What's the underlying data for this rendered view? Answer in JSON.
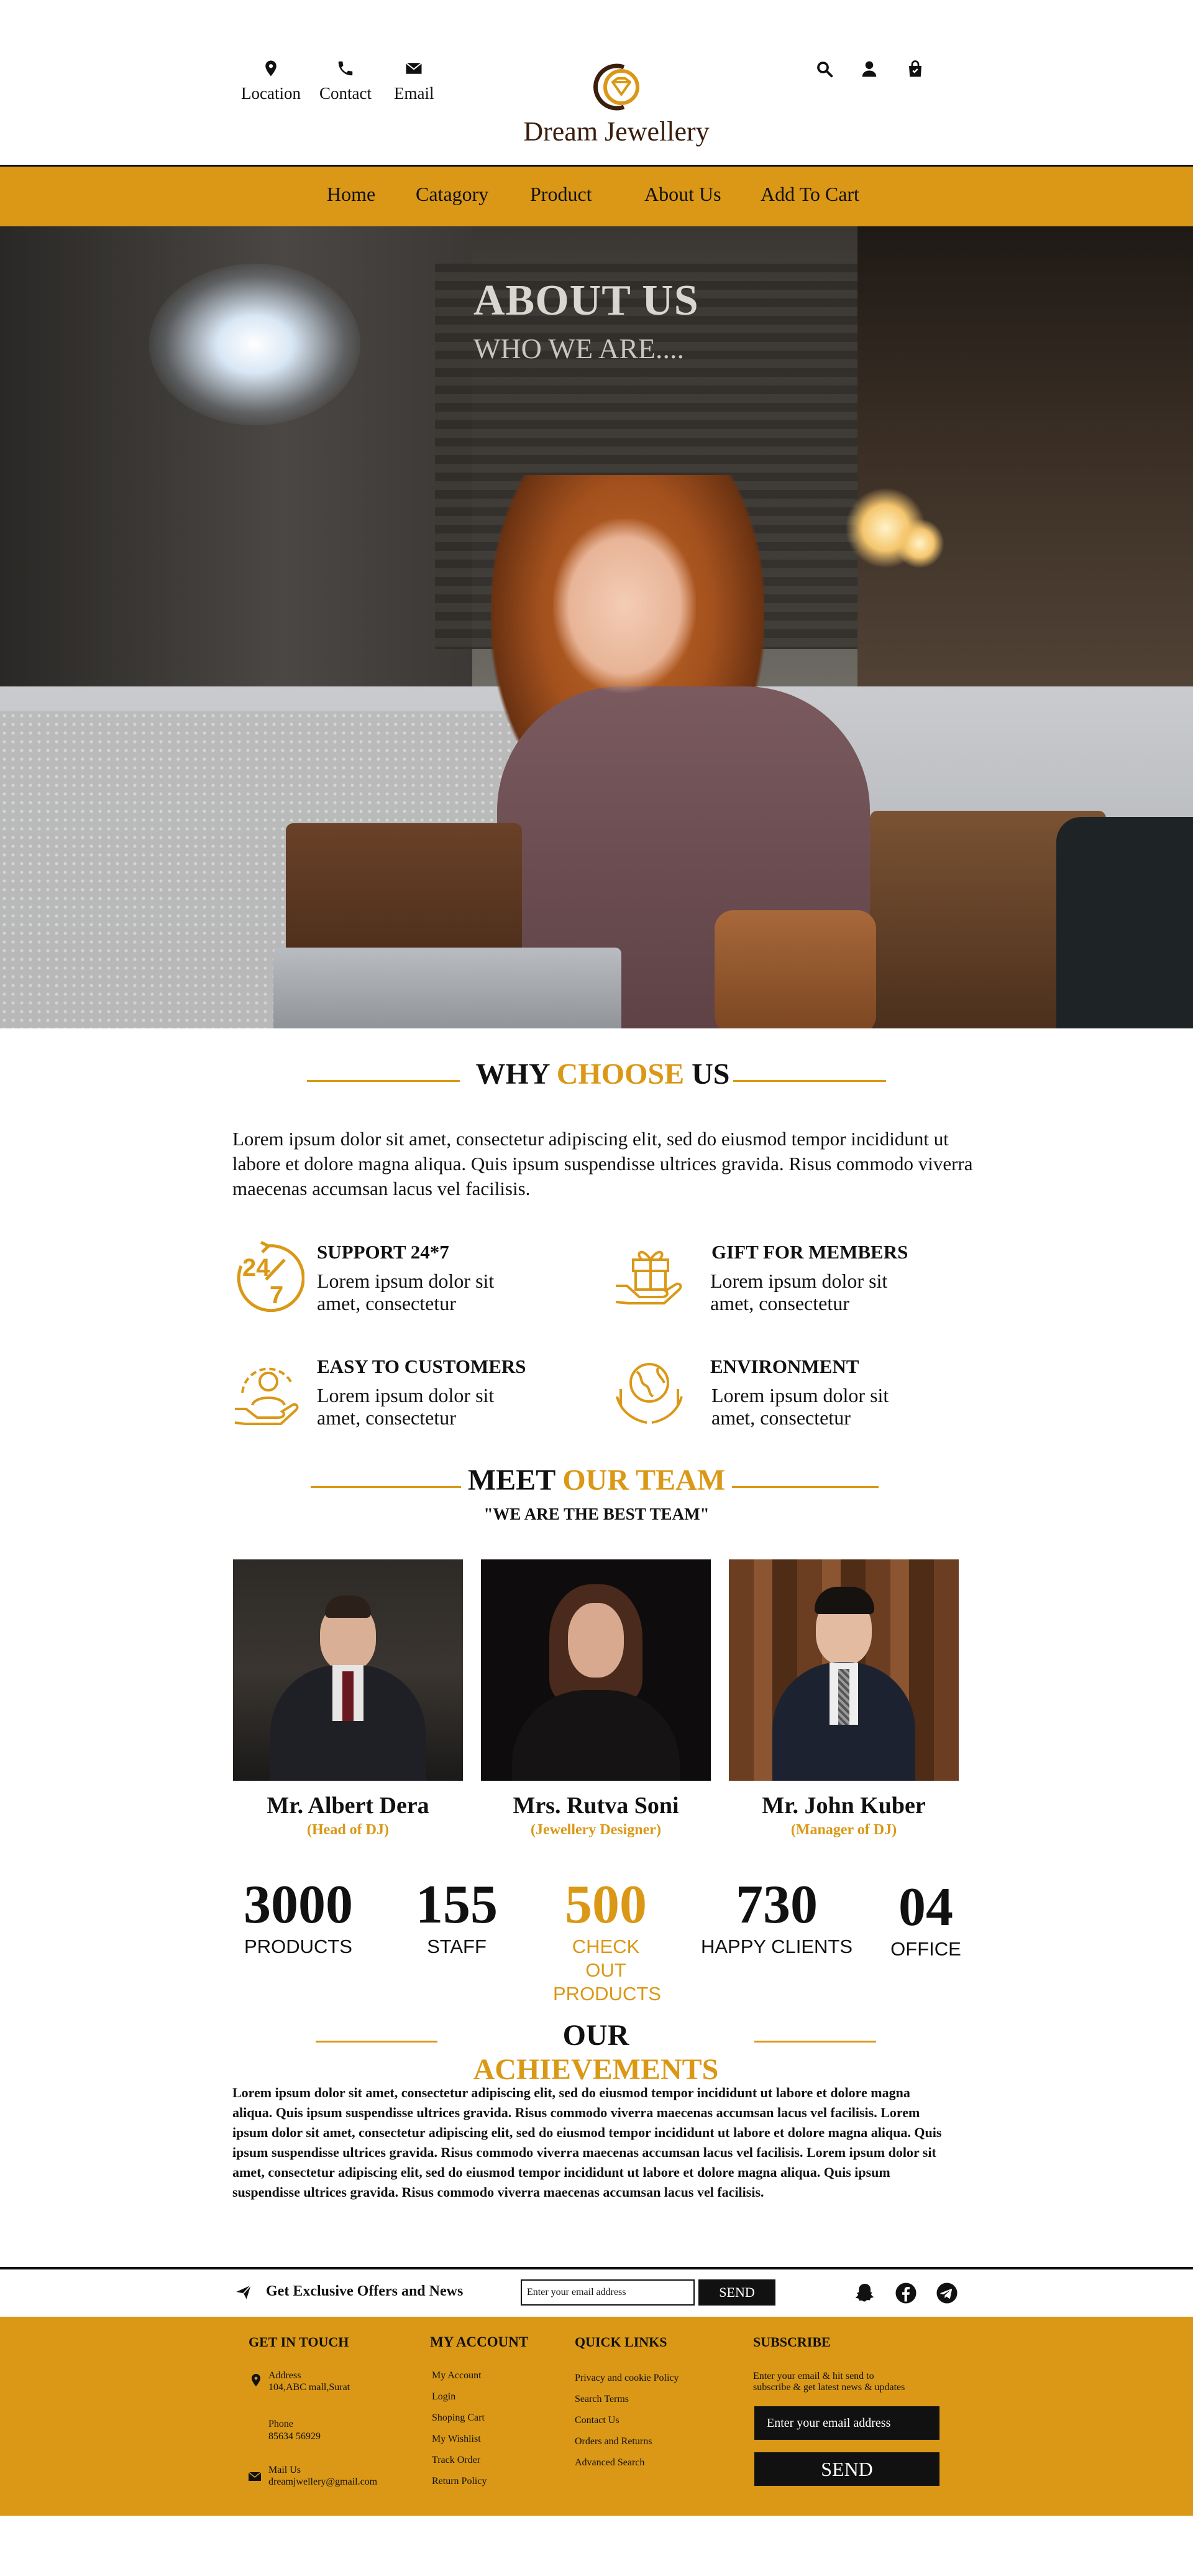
{
  "header": {
    "left_items": [
      {
        "label": "Location",
        "icon": "location-pin-icon"
      },
      {
        "label": "Contact",
        "icon": "phone-icon"
      },
      {
        "label": "Email",
        "icon": "envelope-icon"
      }
    ],
    "brand": "Dream Jewellery",
    "right_icons": [
      "search-icon",
      "user-icon",
      "shopping-bag-icon"
    ]
  },
  "nav": {
    "items": [
      "Home",
      "Catagory",
      "Product",
      "About Us",
      "Add To Cart"
    ]
  },
  "hero": {
    "title": "ABOUT US",
    "subtitle": "WHO WE ARE...."
  },
  "why": {
    "title_a": "WHY ",
    "title_b": "CHOOSE",
    "title_c": " US",
    "intro": "Lorem ipsum dolor sit amet, consectetur adipiscing elit, sed do eiusmod tempor incididunt ut labore et dolore magna aliqua. Quis ipsum suspendisse ultrices gravida. Risus commodo viverra maecenas accumsan lacus vel facilisis.",
    "features": [
      {
        "title": "SUPPORT 24*7",
        "desc": "Lorem ipsum dolor sit amet, consectetur",
        "icon": "support-24-7-icon"
      },
      {
        "title": "GIFT FOR MEMBERS",
        "desc": "Lorem ipsum dolor sit amet, consectetur",
        "icon": "gift-icon"
      },
      {
        "title": "EASY TO CUSTOMERS",
        "desc": "Lorem ipsum dolor sit amet, consectetur",
        "icon": "customer-icon"
      },
      {
        "title": "ENVIRONMENT",
        "desc": "Lorem ipsum dolor sit amet, consectetur",
        "icon": "globe-hands-icon"
      }
    ]
  },
  "team": {
    "title_a": "MEET ",
    "title_b": "OUR TEAM",
    "tagline": "\"WE ARE THE BEST TEAM\"",
    "members": [
      {
        "name": "Mr. Albert Dera",
        "role": "(Head of DJ)"
      },
      {
        "name": "Mrs. Rutva Soni",
        "role": "(Jewellery Designer)"
      },
      {
        "name": "Mr. John Kuber",
        "role": "(Manager of DJ)"
      }
    ]
  },
  "stats": [
    {
      "value": "3000",
      "label": "PRODUCTS"
    },
    {
      "value": "155",
      "label": "STAFF"
    },
    {
      "value": "500",
      "label": "CHECK OUT PRODUCTS"
    },
    {
      "value": "730",
      "label": "HAPPY CLIENTS"
    },
    {
      "value": "04",
      "label": "OFFICE"
    }
  ],
  "achievements": {
    "title_a": "OUR ",
    "title_b": "ACHIEVEMENTS",
    "text": "Lorem ipsum dolor sit amet, consectetur adipiscing elit, sed do eiusmod tempor incididunt ut labore et dolore magna aliqua. Quis ipsum suspendisse ultrices gravida. Risus commodo viverra maecenas accumsan lacus vel facilisis. Lorem ipsum dolor sit amet, consectetur adipiscing elit, sed do eiusmod tempor incididunt ut labore et dolore magna aliqua. Quis ipsum suspendisse ultrices gravida. Risus commodo viverra maecenas accumsan lacus vel facilisis. Lorem ipsum dolor sit amet, consectetur adipiscing elit, sed do eiusmod tempor incididunt ut labore et dolore magna aliqua. Quis ipsum suspendisse ultrices gravida. Risus commodo viverra maecenas accumsan lacus vel facilisis."
  },
  "newsletter": {
    "label": "Get Exclusive Offers and News",
    "placeholder": "Enter your email address",
    "button": "SEND",
    "social": [
      "snapchat-icon",
      "facebook-icon",
      "telegram-icon"
    ]
  },
  "footer": {
    "contact_title": "GET IN TOUCH",
    "address_label": "Address",
    "address_value": "104,ABC mall,Surat",
    "phone_label": "Phone",
    "phone_value": "85634 56929",
    "mail_label": "Mail Us",
    "mail_value": "dreamjwellery@gmail.com",
    "account_title": "MY ACCOUNT",
    "account_links": [
      "My Account",
      "Login",
      "Shoping Cart",
      "My Wishlist",
      "Track Order",
      "Return Policy"
    ],
    "quick_title": "QUICK LINKS",
    "quick_links": [
      "Privacy and cookie Policy",
      "Search Terms",
      "Contact Us",
      "Orders and Returns",
      "Advanced Search"
    ],
    "subscribe_title": "SUBSCRIBE",
    "subscribe_text_1": "Enter your email & hit send to",
    "subscribe_text_2": "subscribe & get latest news & updates",
    "subscribe_placeholder": "Enter your email address",
    "subscribe_button": "SEND"
  },
  "colors": {
    "accent": "#DA9816",
    "dark": "#111111",
    "brand_text": "#3a1e0e"
  }
}
